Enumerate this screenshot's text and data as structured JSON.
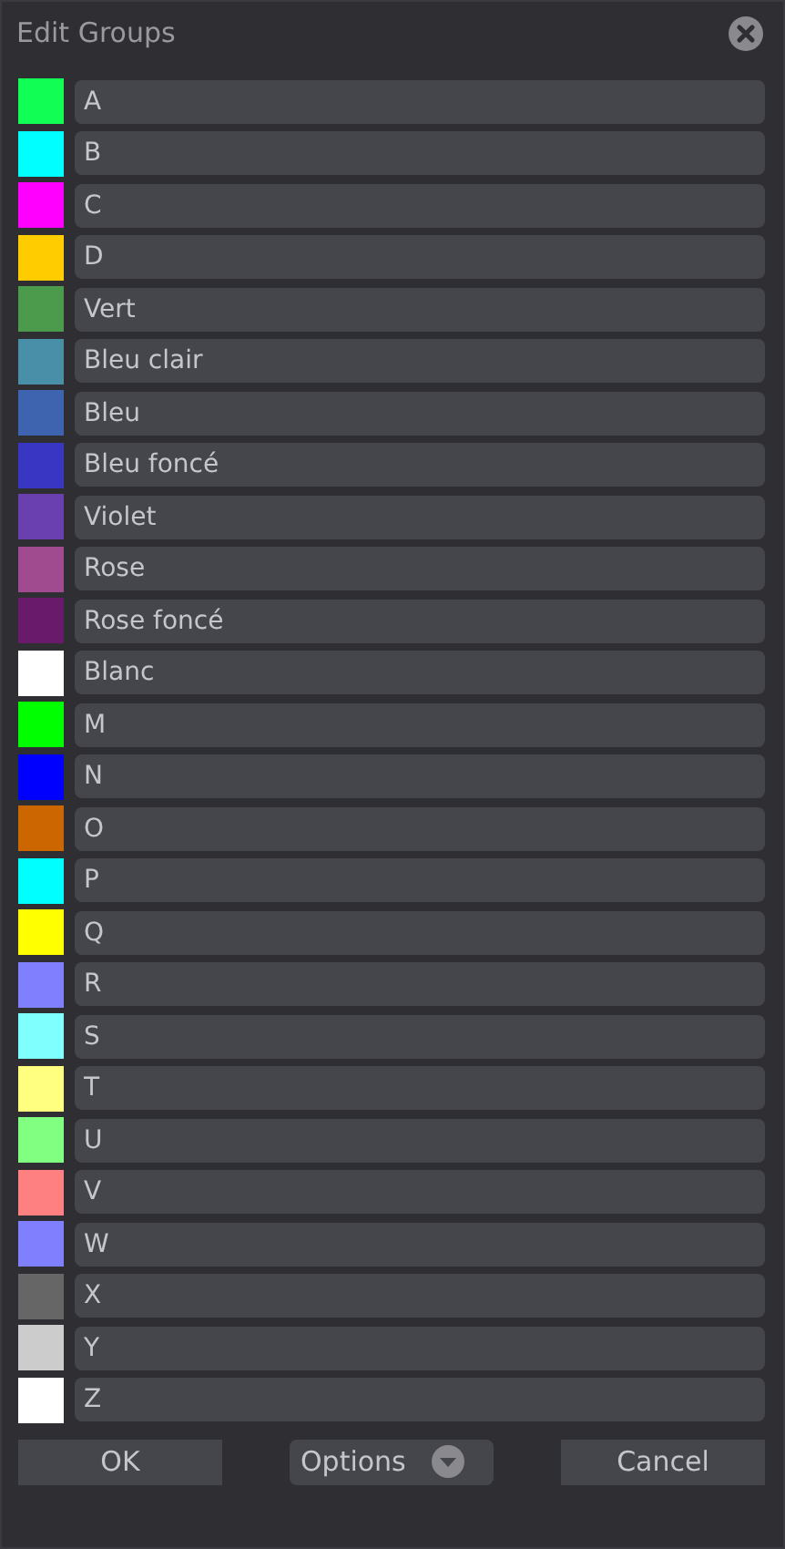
{
  "window": {
    "title": "Edit Groups"
  },
  "groups": [
    {
      "name": "A",
      "color": "#11ff55"
    },
    {
      "name": "B",
      "color": "#00ffff"
    },
    {
      "name": "C",
      "color": "#ff00ff"
    },
    {
      "name": "D",
      "color": "#ffcc00"
    },
    {
      "name": "Vert",
      "color": "#4c9a4c"
    },
    {
      "name": "Bleu clair",
      "color": "#4a8fa8"
    },
    {
      "name": "Bleu",
      "color": "#3e64b0"
    },
    {
      "name": "Bleu foncé",
      "color": "#3a36c4"
    },
    {
      "name": "Violet",
      "color": "#6a40b0"
    },
    {
      "name": "Rose",
      "color": "#a04a90"
    },
    {
      "name": "Rose foncé",
      "color": "#6a1a6a"
    },
    {
      "name": "Blanc",
      "color": "#ffffff"
    },
    {
      "name": "M",
      "color": "#00ff00"
    },
    {
      "name": "N",
      "color": "#0000ff"
    },
    {
      "name": "O",
      "color": "#cc6600"
    },
    {
      "name": "P",
      "color": "#00ffff"
    },
    {
      "name": "Q",
      "color": "#ffff00"
    },
    {
      "name": "R",
      "color": "#8080ff"
    },
    {
      "name": "S",
      "color": "#80ffff"
    },
    {
      "name": "T",
      "color": "#ffff80"
    },
    {
      "name": "U",
      "color": "#80ff80"
    },
    {
      "name": "V",
      "color": "#ff8080"
    },
    {
      "name": "W",
      "color": "#8080ff"
    },
    {
      "name": "X",
      "color": "#666666"
    },
    {
      "name": "Y",
      "color": "#cccccc"
    },
    {
      "name": "Z",
      "color": "#ffffff"
    }
  ],
  "buttons": [
    {
      "label": "OK",
      "kind": "plain"
    },
    {
      "label": "Options",
      "kind": "menu"
    },
    {
      "label": "Cancel",
      "kind": "plain"
    }
  ]
}
